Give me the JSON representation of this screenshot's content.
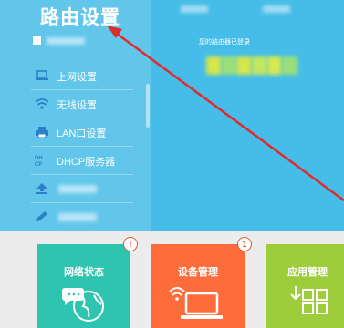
{
  "sidebar": {
    "title": "路由设置",
    "menu": [
      {
        "label": "上网设置",
        "icon": "laptop-icon"
      },
      {
        "label": "无线设置",
        "icon": "wifi-icon"
      },
      {
        "label": "LAN口设置",
        "icon": "printer-icon"
      },
      {
        "label": "DHCP服务器",
        "icon": "dhcp-icon"
      },
      {
        "label": "",
        "icon": "upload-icon"
      },
      {
        "label": "",
        "icon": "pencil-icon"
      }
    ]
  },
  "main": {
    "login_text": "您的路由器已登录"
  },
  "cards": [
    {
      "title": "网络状态",
      "badge": "!",
      "color": "#2fc4b0",
      "icon": "globe-chat-icon"
    },
    {
      "title": "设备管理",
      "badge": "1",
      "color": "#ff6c3c",
      "icon": "laptop-wifi-icon"
    },
    {
      "title": "应用管理",
      "badge": "",
      "color": "#9dcd3a",
      "icon": "app-grid-icon"
    }
  ],
  "colors": {
    "header_blue": "#45bde8",
    "sidebar_blue": "#62c6eb",
    "arrow_red": "#e02b2b"
  }
}
